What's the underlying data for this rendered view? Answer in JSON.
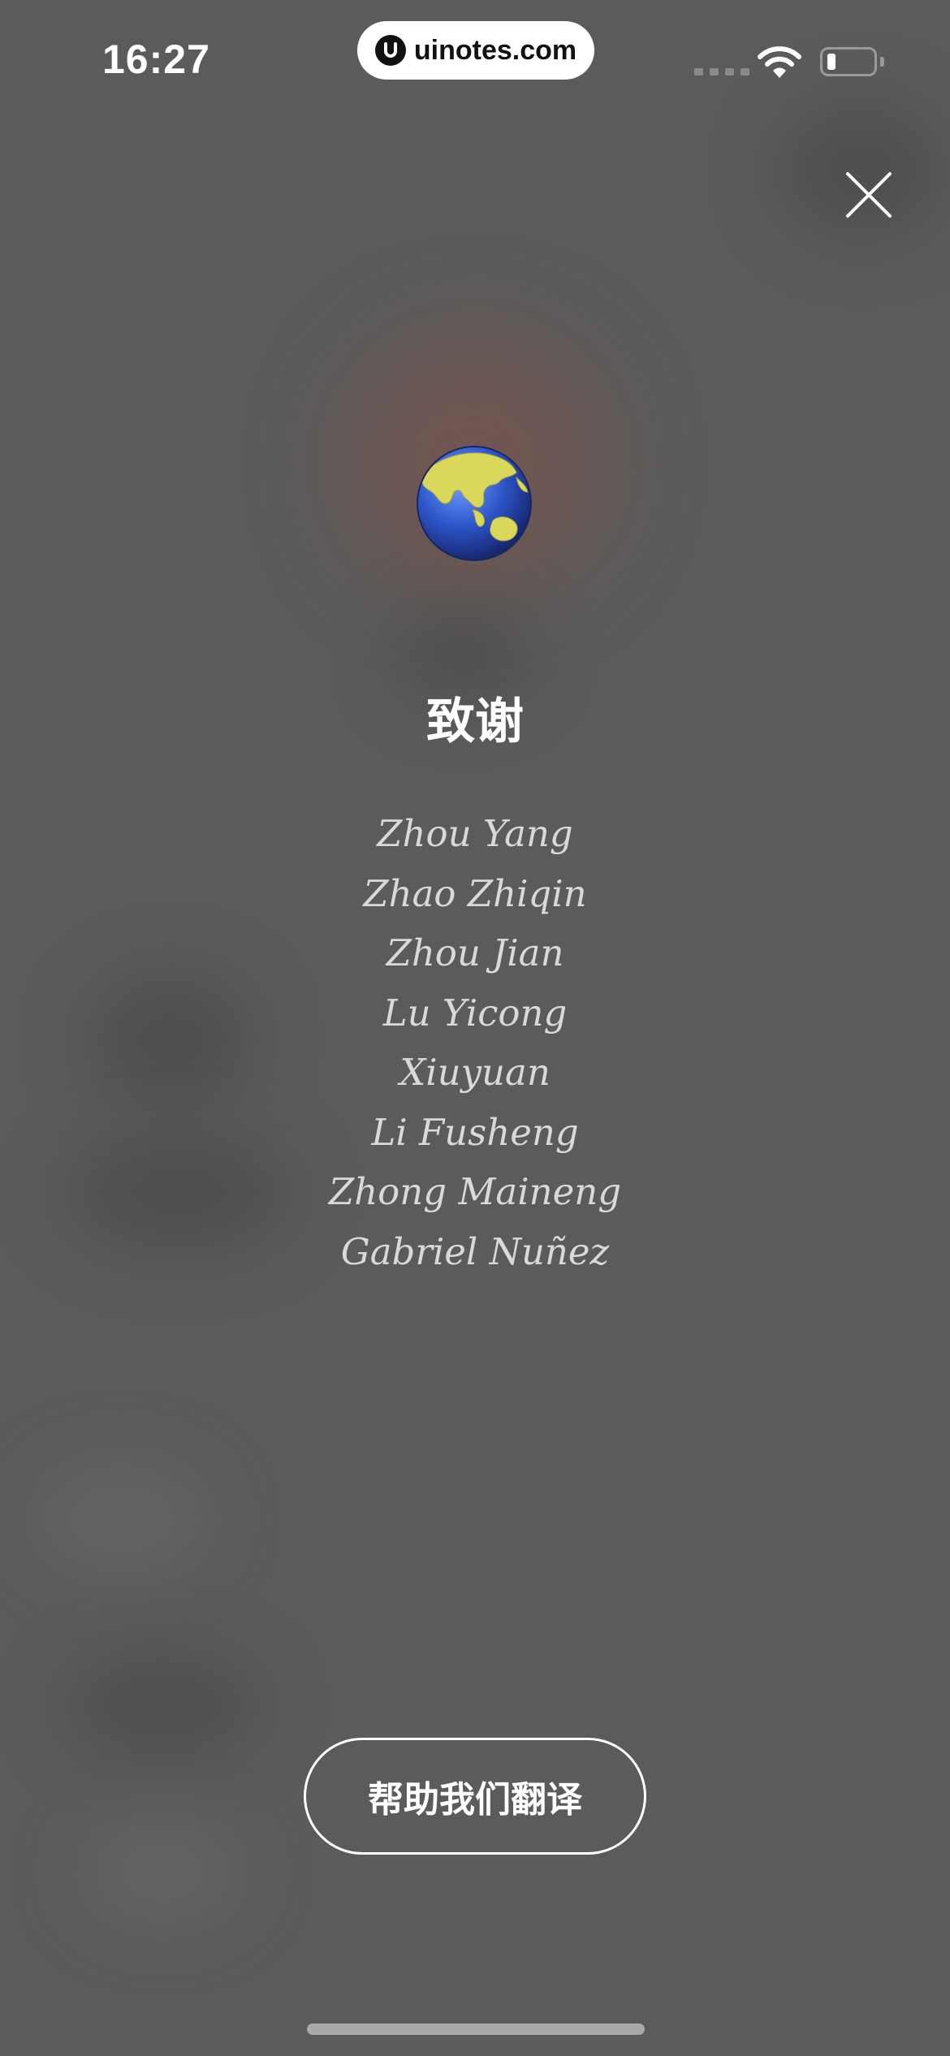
{
  "status_bar": {
    "time": "16:27",
    "url": "uinotes.com"
  },
  "title": "致谢",
  "names": [
    "Zhou Yang",
    "Zhao Zhiqin",
    "Zhou Jian",
    "Lu Yicong",
    "Xiuyuan",
    "Li Fusheng",
    "Zhong Maineng",
    "Gabriel Nuñez"
  ],
  "translate_button": "帮助我们翻译",
  "icons": {
    "close": "close-icon",
    "globe": "globe-icon",
    "wifi": "wifi-icon",
    "battery": "battery-icon"
  },
  "colors": {
    "background": "#5b5b5b",
    "text": "#ffffff",
    "names": "#d9d9d9"
  }
}
